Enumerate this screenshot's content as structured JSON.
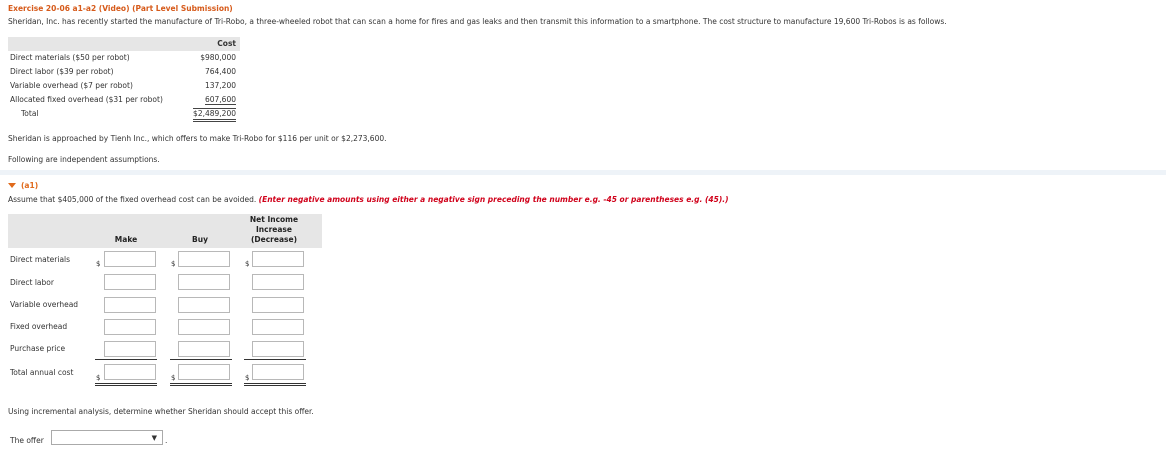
{
  "header": {
    "title": "Exercise 20-06 a1-a2 (Video) (Part Level Submission)",
    "intro": "Sheridan, Inc. has recently started the manufacture of Tri-Robo, a three-wheeled robot that can scan a home for fires and gas leaks and then transmit this information to a smartphone. The cost structure to manufacture 19,600 Tri-Robos is as follows."
  },
  "cost_table": {
    "header": "Cost",
    "rows": [
      {
        "label": "Direct materials ($50 per robot)",
        "value": "$980,000"
      },
      {
        "label": "Direct labor ($39 per robot)",
        "value": "764,400"
      },
      {
        "label": "Variable overhead ($7 per robot)",
        "value": "137,200"
      },
      {
        "label": "Allocated fixed overhead ($31 per robot)",
        "value": "607,600"
      },
      {
        "label": "Total",
        "value": "$2,489,200"
      }
    ]
  },
  "approach_text": "Sheridan is approached by Tienh Inc., which offers to make Tri-Robo for $116 per unit or $2,273,600.",
  "assumptions_text": "Following are independent assumptions.",
  "part_a1": {
    "label": "(a1)",
    "assume_text": "Assume that $405,000 of the fixed overhead cost can be avoided.",
    "instruction": "(Enter negative amounts using either a negative sign preceding the number e.g. -45 or parentheses e.g. (45).)",
    "columns": {
      "make": "Make",
      "buy": "Buy",
      "net_line1": "Net Income",
      "net_line2": "Increase",
      "net_line3": "(Decrease)"
    },
    "rows": [
      "Direct materials",
      "Direct labor",
      "Variable overhead",
      "Fixed overhead",
      "Purchase price",
      "Total annual cost"
    ],
    "currency_symbol": "$",
    "question": "Using incremental analysis, determine whether Sheridan should accept this offer.",
    "offer_label": "The offer",
    "offer_selected": "",
    "trailing_period": "."
  },
  "colors": {
    "title": "#d65a1a",
    "instruction": "#d0021b",
    "accent": "#e06a1c"
  }
}
